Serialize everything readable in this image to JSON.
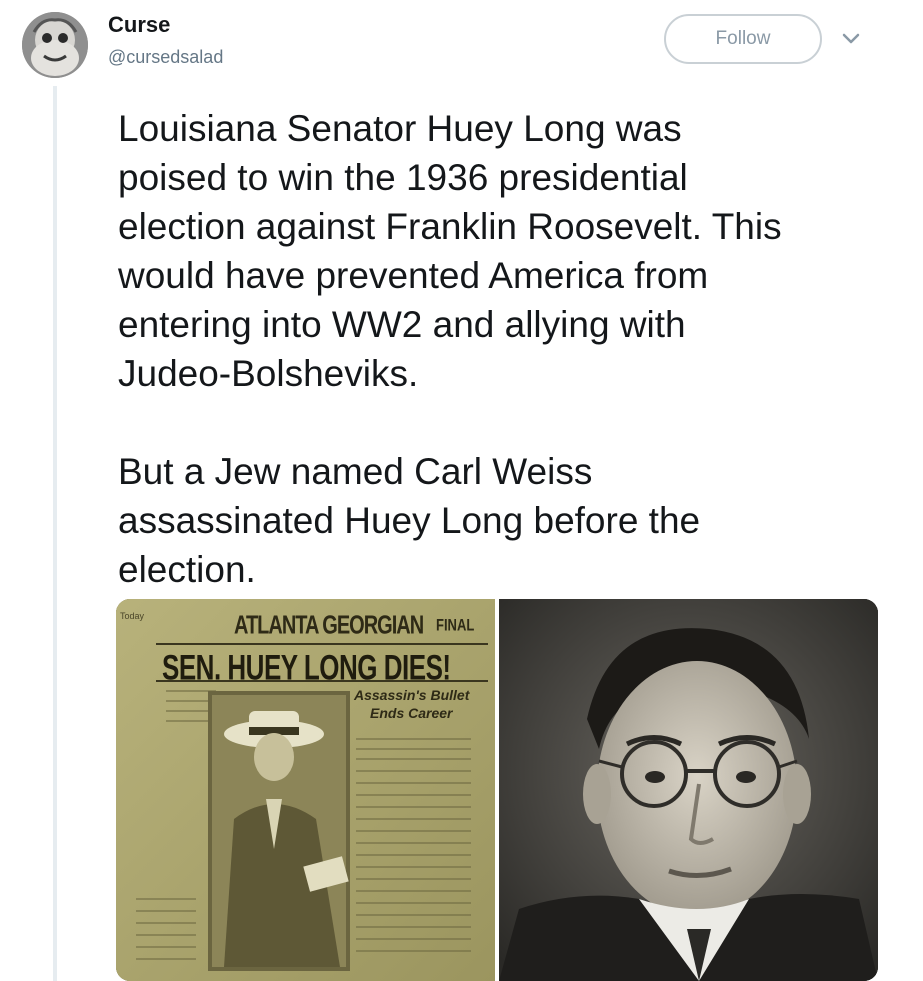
{
  "author": {
    "display_name": "Curse",
    "handle": "@cursedsalad"
  },
  "follow_label": "Follow",
  "tweet_text": "Louisiana Senator Huey Long was\npoised to win the 1936 presidential\nelection against Franklin Roosevelt. This\nwould have prevented America from\nentering into WW2 and allying with\nJudeo-Bolsheviks.\n\nBut a Jew named Carl Weiss\nassassinated Huey Long before the\nelection.",
  "media": {
    "newspaper": {
      "corner": "Today",
      "masthead": "ATLANTA GEORGIAN",
      "edition": "FINAL",
      "headline": "SEN. HUEY LONG DIES!",
      "subhead_line1": "Assassin's Bullet",
      "subhead_line2": "Ends Career"
    }
  },
  "colors": {
    "text": "#14171a",
    "secondary": "#657786",
    "border": "#c9d0d5",
    "newspaper": "#a9a36a"
  }
}
